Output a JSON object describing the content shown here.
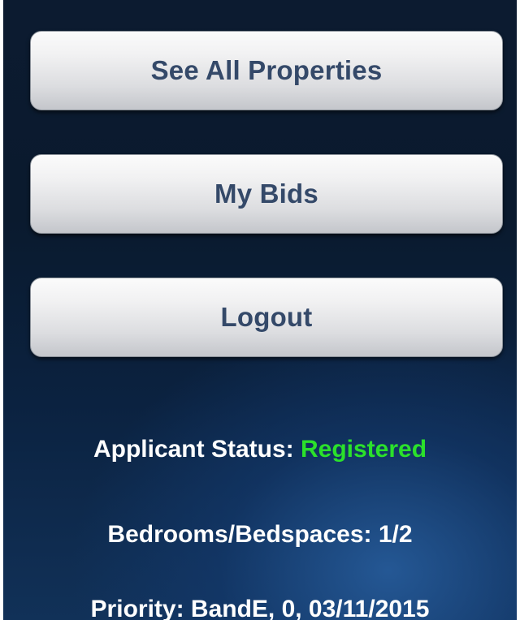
{
  "menu": {
    "see_all_properties": "See All Properties",
    "my_bids": "My Bids",
    "logout": "Logout"
  },
  "applicant": {
    "status_label": "Applicant Status:",
    "status_value": "Registered",
    "bedrooms_text": "Bedrooms/Bedspaces: 1/2",
    "priority_text": "Priority: BandE, 0, 03/11/2015"
  },
  "colors": {
    "button_text": "#344969",
    "status_registered": "#2be12b",
    "background_dark": "#0a1a2e",
    "background_glow": "#285fa0"
  }
}
